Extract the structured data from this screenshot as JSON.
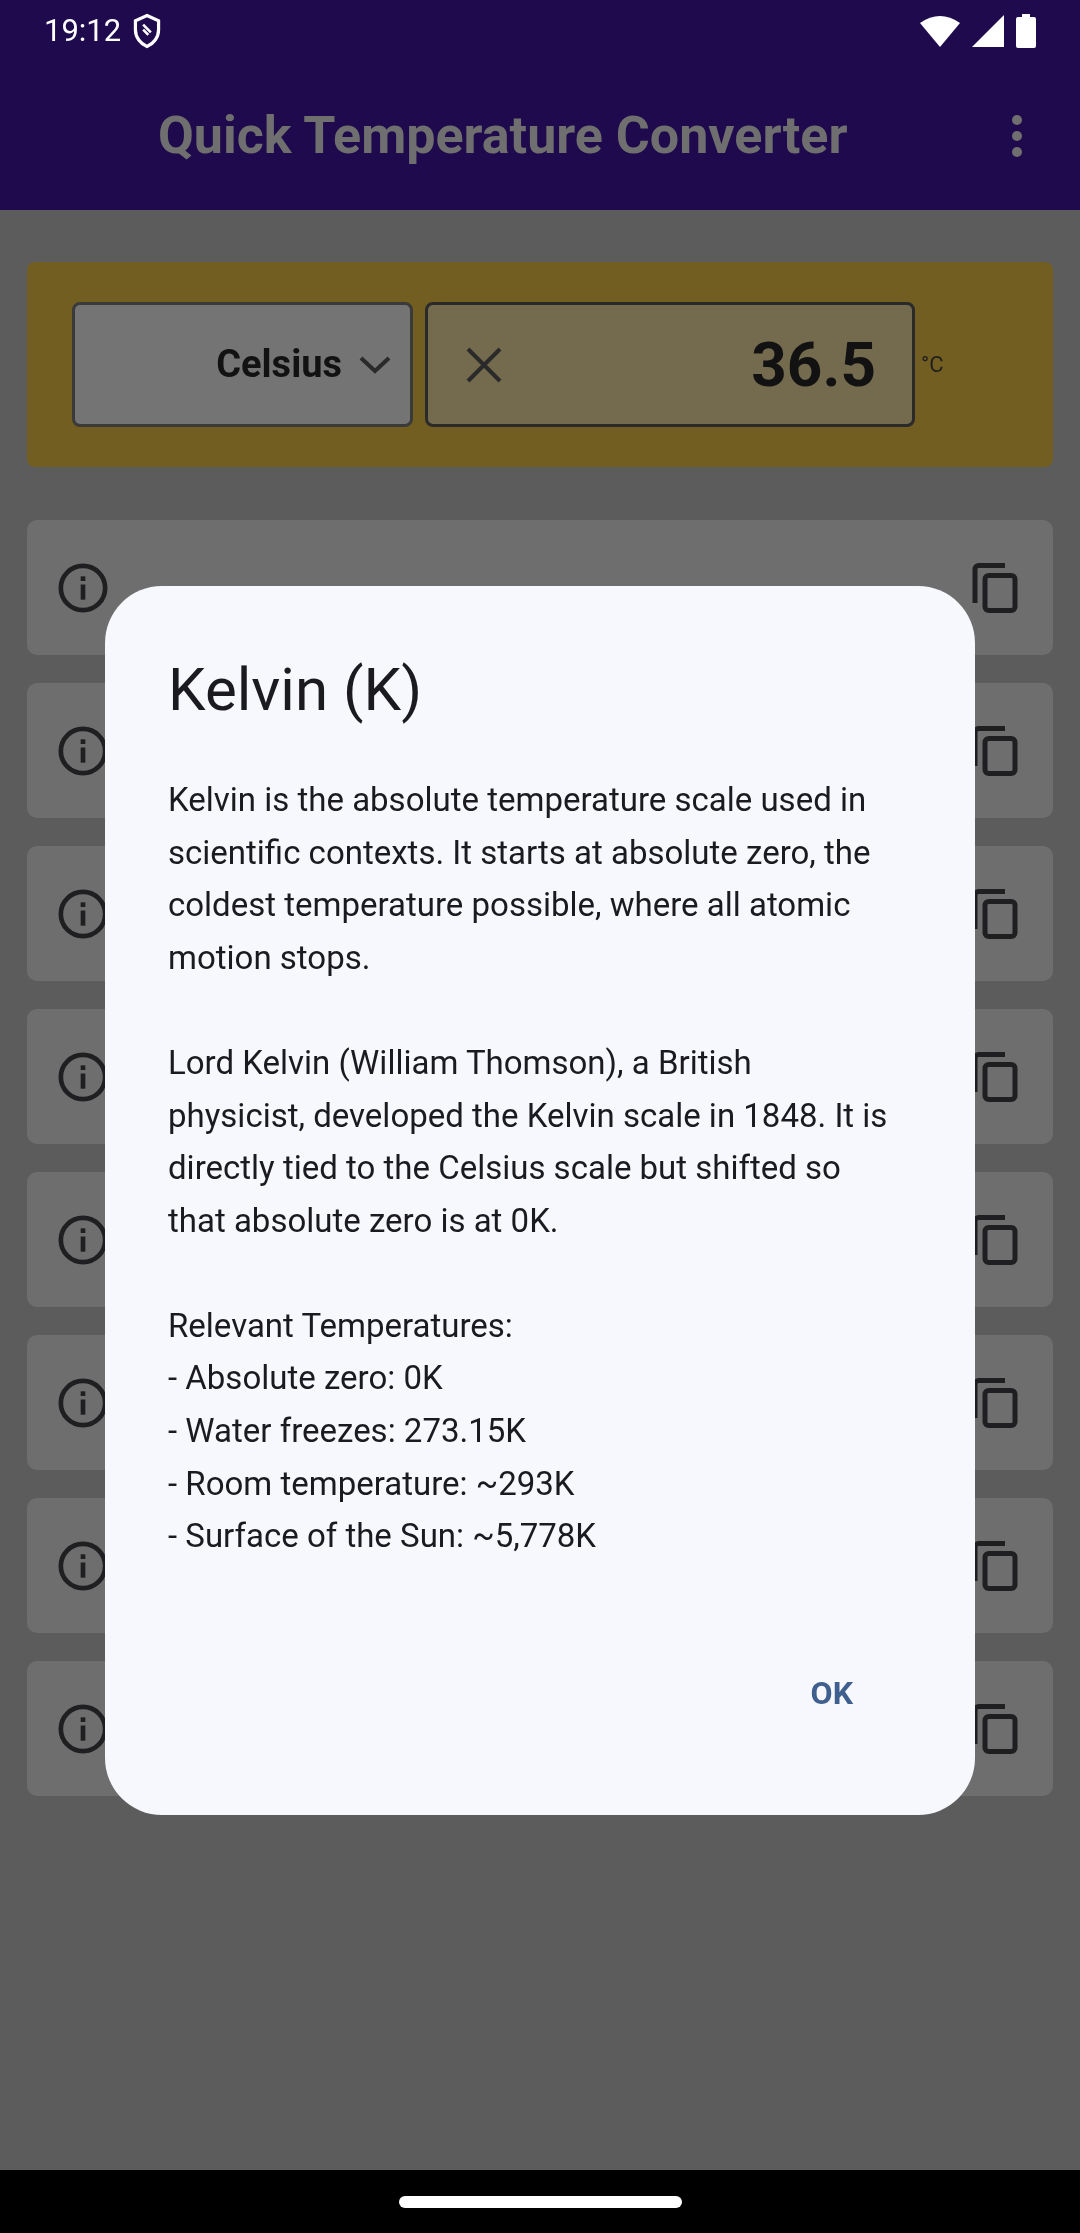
{
  "status_bar": {
    "time": "19:12"
  },
  "app_bar": {
    "title": "Quick Temperature Converter"
  },
  "converter": {
    "unit": "Celsius",
    "value": "36.5",
    "unit_symbol": "°C"
  },
  "result_cards": [
    {
      "kind": "covered"
    },
    {
      "kind": "covered"
    },
    {
      "kind": "covered"
    },
    {
      "kind": "covered"
    },
    {
      "kind": "covered"
    },
    {
      "kind": "covered"
    },
    {
      "kind": "covered"
    },
    {
      "kind": "covered"
    }
  ],
  "dialog": {
    "title": "Kelvin (K)",
    "paragraphs": [
      "Kelvin is the absolute temperature scale used in scientific contexts. It starts at absolute zero, the coldest temperature possible, where all atomic motion stops.",
      "Lord Kelvin (William Thomson), a British physicist, developed the Kelvin scale in 1848. It is directly tied to the Celsius scale but shifted so that absolute zero is at 0K.",
      "Relevant Temperatures:\n- Absolute zero: 0K\n- Water freezes: 273.15K\n- Room temperature: ~293K\n- Surface of the Sun: ~5,778K"
    ],
    "button": "OK"
  }
}
